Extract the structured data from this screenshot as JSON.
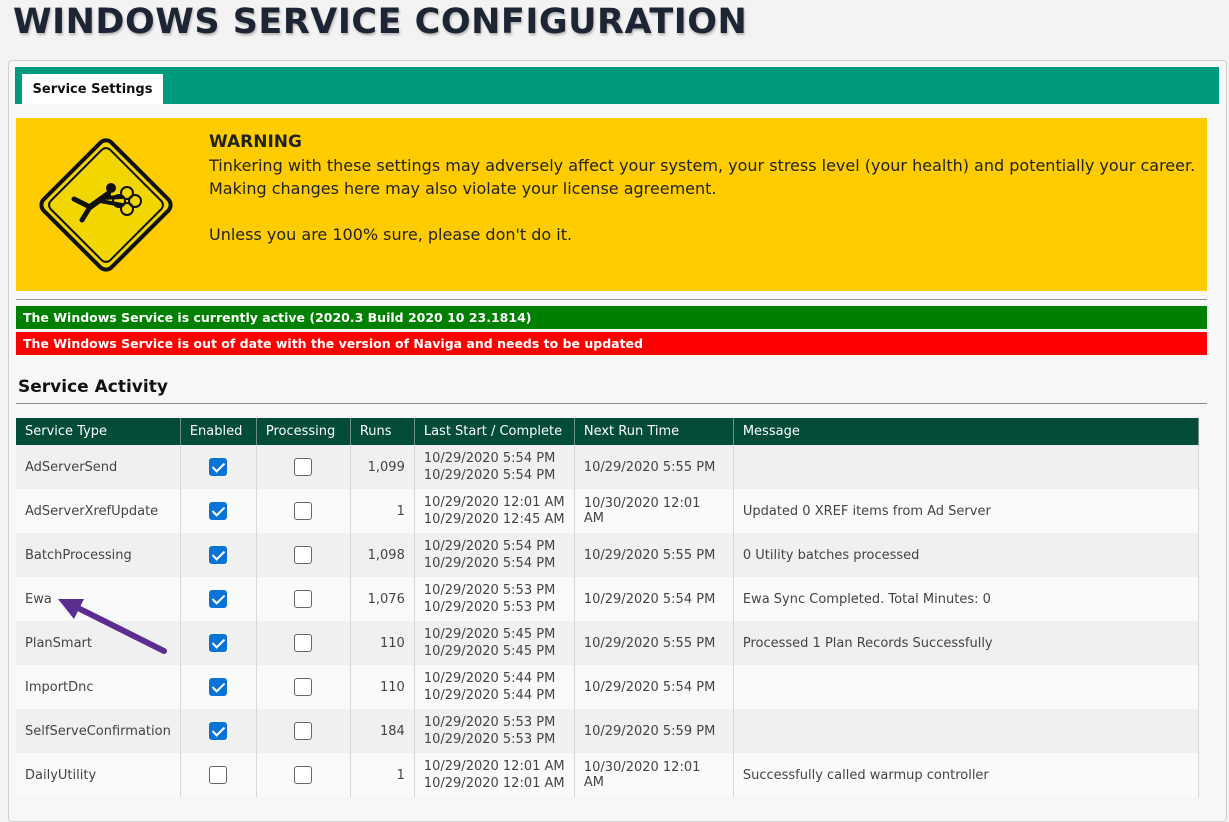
{
  "page": {
    "title": "WINDOWS SERVICE CONFIGURATION"
  },
  "tabs": [
    {
      "label": "Service Settings",
      "active": true
    }
  ],
  "warning": {
    "heading": "WARNING",
    "line1": "Tinkering with these settings may adversely affect your system, your stress level (your health) and potentially your career.",
    "line2": "Making changes here may also violate your license agreement.",
    "line3": "Unless you are 100% sure, please don't do it.",
    "icon": "falling-person-warning-icon",
    "color": "#ffcc00"
  },
  "status": {
    "active": "The Windows Service is currently active (2020.3 Build 2020 10 23.1814)",
    "outdated": "The Windows Service is out of date with the version of Naviga and needs to be updated",
    "active_color": "#008000",
    "outdated_color": "#ff0000"
  },
  "activity": {
    "title": "Service Activity",
    "columns": [
      "Service Type",
      "Enabled",
      "Processing",
      "Runs",
      "Last Start / Complete",
      "Next Run Time",
      "Message"
    ],
    "rows": [
      {
        "type": "AdServerSend",
        "enabled": true,
        "processing": false,
        "runs": "1,099",
        "start": "10/29/2020 5:54 PM",
        "complete": "10/29/2020 5:54 PM",
        "next": "10/29/2020 5:55 PM",
        "message": ""
      },
      {
        "type": "AdServerXrefUpdate",
        "enabled": true,
        "processing": false,
        "runs": "1",
        "start": "10/29/2020 12:01 AM",
        "complete": "10/29/2020 12:45 AM",
        "next": "10/30/2020 12:01 AM",
        "message": "Updated 0 XREF items from Ad Server"
      },
      {
        "type": "BatchProcessing",
        "enabled": true,
        "processing": false,
        "runs": "1,098",
        "start": "10/29/2020 5:54 PM",
        "complete": "10/29/2020 5:54 PM",
        "next": "10/29/2020 5:55 PM",
        "message": "0 Utility batches processed"
      },
      {
        "type": "Ewa",
        "enabled": true,
        "processing": false,
        "runs": "1,076",
        "start": "10/29/2020 5:53 PM",
        "complete": "10/29/2020 5:53 PM",
        "next": "10/29/2020 5:54 PM",
        "message": "Ewa Sync Completed. Total Minutes: 0"
      },
      {
        "type": "PlanSmart",
        "enabled": true,
        "processing": false,
        "runs": "110",
        "start": "10/29/2020 5:45 PM",
        "complete": "10/29/2020 5:45 PM",
        "next": "10/29/2020 5:55 PM",
        "message": "Processed 1 Plan Records Successfully"
      },
      {
        "type": "ImportDnc",
        "enabled": true,
        "processing": false,
        "runs": "110",
        "start": "10/29/2020 5:44 PM",
        "complete": "10/29/2020 5:44 PM",
        "next": "10/29/2020 5:54 PM",
        "message": ""
      },
      {
        "type": "SelfServeConfirmation",
        "enabled": true,
        "processing": false,
        "runs": "184",
        "start": "10/29/2020 5:53 PM",
        "complete": "10/29/2020 5:53 PM",
        "next": "10/29/2020 5:59 PM",
        "message": ""
      },
      {
        "type": "DailyUtility",
        "enabled": false,
        "processing": false,
        "runs": "1",
        "start": "10/29/2020 12:01 AM",
        "complete": "10/29/2020 12:01 AM",
        "next": "10/30/2020 12:01 AM",
        "message": "Successfully called warmup controller"
      }
    ]
  },
  "colors": {
    "tabbar": "#009b7d",
    "header": "#034d38",
    "checkbox": "#0a74d6",
    "arrow": "#5b2d91"
  }
}
